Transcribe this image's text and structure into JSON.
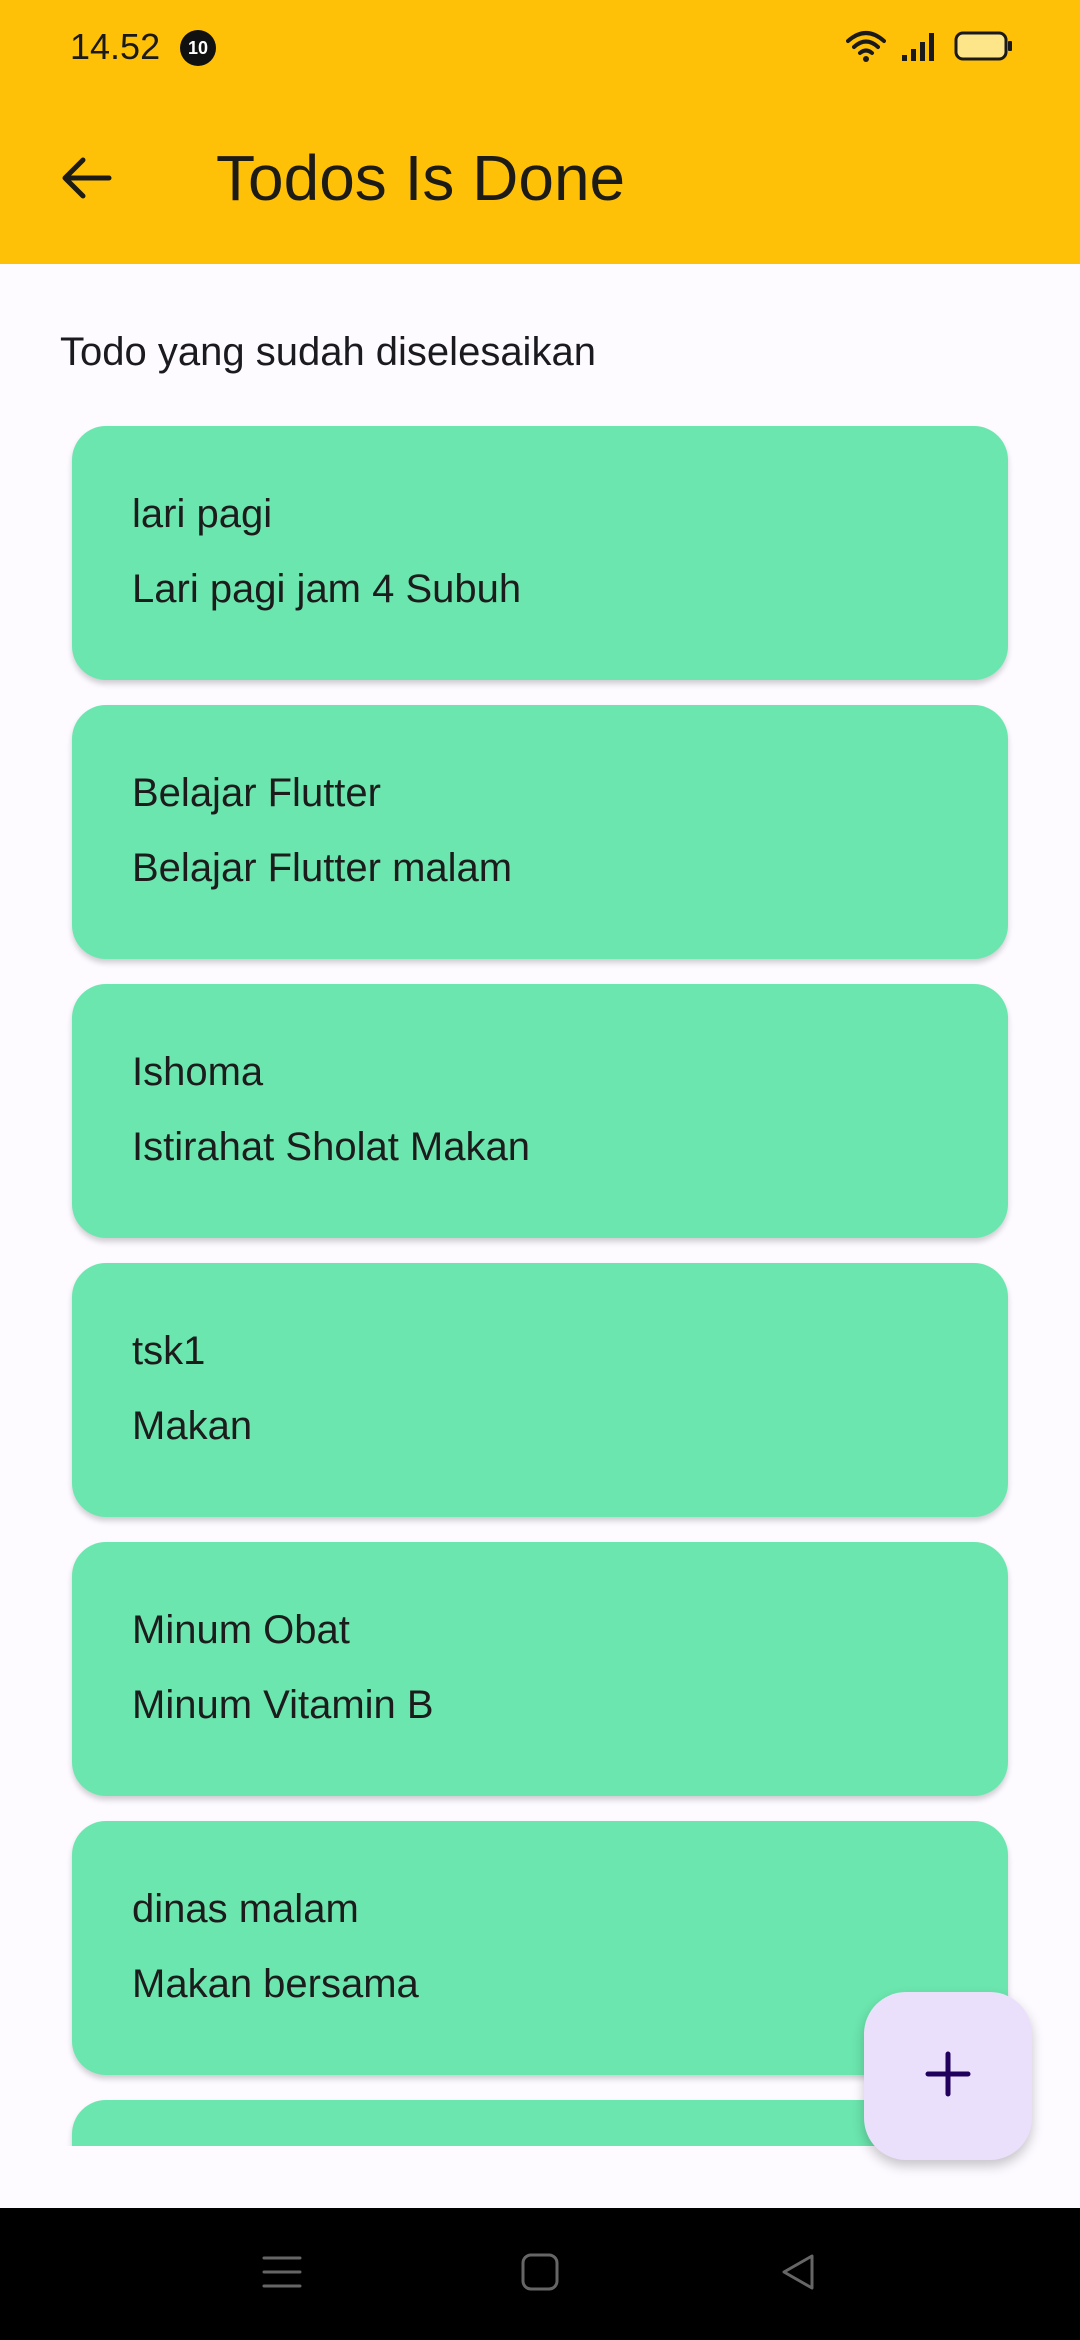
{
  "status_bar": {
    "time": "14.52",
    "notification_count": "10"
  },
  "app_bar": {
    "title": "Todos Is Done",
    "background_color": "#ffc107"
  },
  "page": {
    "subtitle": "Todo yang sudah diselesaikan",
    "card_color": "#6be6ae"
  },
  "todos": [
    {
      "title": "lari pagi",
      "description": "Lari pagi jam 4 Subuh"
    },
    {
      "title": "Belajar Flutter",
      "description": "Belajar Flutter malam"
    },
    {
      "title": "Ishoma",
      "description": "Istirahat Sholat Makan"
    },
    {
      "title": "tsk1",
      "description": "Makan"
    },
    {
      "title": "Minum Obat",
      "description": "Minum Vitamin B"
    },
    {
      "title": "dinas malam",
      "description": "Makan bersama"
    },
    {
      "title": "",
      "description": ""
    }
  ],
  "icons": {
    "back": "arrow-back-icon",
    "fab": "plus-icon",
    "wifi": "wifi-icon",
    "signal": "signal-icon",
    "battery": "battery-icon",
    "nav_menu": "menu-icon",
    "nav_home": "home-square-icon",
    "nav_back": "back-triangle-icon"
  }
}
